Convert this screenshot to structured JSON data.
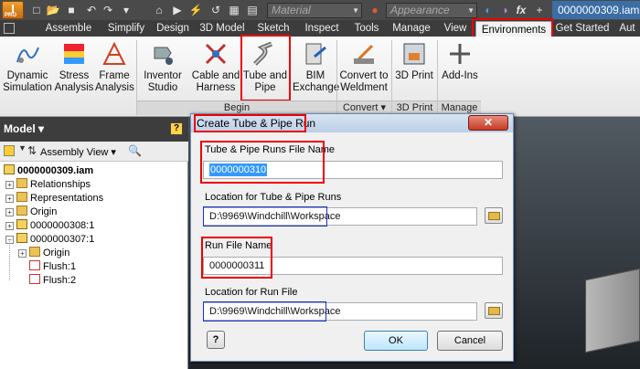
{
  "titlebar": {
    "app_letter": "I",
    "app_badge": "PRO",
    "material_placeholder": "Material",
    "appearance_placeholder": "Appearance",
    "fx_label": "fx",
    "document_title": "0000000309.iam"
  },
  "tabs": [
    "Assemble",
    "Simplify",
    "Design",
    "3D Model",
    "Sketch",
    "Inspect",
    "Tools",
    "Manage",
    "View",
    "Environments",
    "Get Started",
    "Aut"
  ],
  "active_tab": "Environments",
  "ribbon": {
    "buttons": [
      {
        "line1": "Dynamic",
        "line2": "Simulation",
        "icon": "dynamic-simulation-icon"
      },
      {
        "line1": "Stress",
        "line2": "Analysis",
        "icon": "stress-analysis-icon"
      },
      {
        "line1": "Frame",
        "line2": "Analysis",
        "icon": "frame-analysis-icon"
      },
      {
        "line1": "Inventor",
        "line2": "Studio",
        "icon": "inventor-studio-icon"
      },
      {
        "line1": "Cable and",
        "line2": "Harness",
        "icon": "cable-harness-icon"
      },
      {
        "line1": "Tube and",
        "line2": "Pipe",
        "icon": "tube-pipe-icon"
      },
      {
        "line1": "BIM",
        "line2": "Exchange",
        "icon": "bim-exchange-icon"
      },
      {
        "line1": "Convert to",
        "line2": "Weldment",
        "icon": "convert-weldment-icon"
      },
      {
        "line1": "3D Print",
        "line2": "",
        "icon": "3d-print-icon"
      },
      {
        "line1": "Add-Ins",
        "line2": "",
        "icon": "add-ins-icon"
      }
    ],
    "groups": [
      "Begin",
      "Convert ▾",
      "3D Print",
      "Manage"
    ]
  },
  "browser": {
    "title": "Model ▾",
    "help": "?",
    "view_label": "Assembly View ▾",
    "tree": [
      {
        "label": "0000000309.iam",
        "level": 0,
        "expander": "",
        "icon": "assembly-icon",
        "bold": true
      },
      {
        "label": "Relationships",
        "level": 1,
        "expander": "+",
        "icon": "folder-icon"
      },
      {
        "label": "Representations",
        "level": 1,
        "expander": "+",
        "icon": "folder-icon"
      },
      {
        "label": "Origin",
        "level": 1,
        "expander": "+",
        "icon": "folder-icon"
      },
      {
        "label": "0000000308:1",
        "level": 1,
        "expander": "+",
        "icon": "part-icon"
      },
      {
        "label": "0000000307:1",
        "level": 1,
        "expander": "−",
        "icon": "part-icon"
      },
      {
        "label": "Origin",
        "level": 2,
        "expander": "+",
        "icon": "folder-icon"
      },
      {
        "label": "Flush:1",
        "level": 2,
        "expander": "",
        "icon": "constraint-icon"
      },
      {
        "label": "Flush:2",
        "level": 2,
        "expander": "",
        "icon": "constraint-icon"
      }
    ]
  },
  "dialog": {
    "title": "Create Tube & Pipe Run",
    "close": "✕",
    "runs_file_label": "Tube & Pipe Runs File Name",
    "runs_file_value": "0000000310",
    "runs_location_label": "Location for Tube & Pipe Runs",
    "runs_location_value": "D:\\9969\\Windchill\\Workspace",
    "run_file_label": "Run File Name",
    "run_file_value": "0000000311",
    "run_location_label": "Location for Run File",
    "run_location_value": "D:\\9969\\Windchill\\Workspace",
    "help": "?",
    "ok": "OK",
    "cancel": "Cancel"
  },
  "colors": {
    "highlight": "#ee0000",
    "outline_blue": "#2030d0",
    "selection": "#3399ff"
  }
}
